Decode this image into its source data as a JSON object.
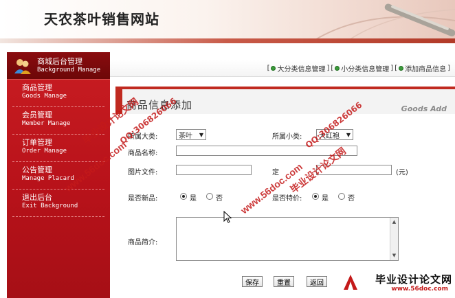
{
  "site": {
    "title": "天农茶叶销售网站"
  },
  "sidebar": {
    "header": {
      "cn": "商城后台管理",
      "en": "Background Manage"
    },
    "items": [
      {
        "cn": "商品管理",
        "en": "Goods Manage"
      },
      {
        "cn": "会员管理",
        "en": "Member Manage"
      },
      {
        "cn": "订单管理",
        "en": "Order Manage"
      },
      {
        "cn": "公告管理",
        "en": "Manage Placard"
      },
      {
        "cn": "退出后台",
        "en": "Exit Background"
      }
    ]
  },
  "topnav": {
    "links": [
      "大分类信息管理",
      "小分类信息管理",
      "添加商品信息"
    ],
    "bracket_open": "[",
    "bracket_close": "]"
  },
  "panel": {
    "title": "商品信息添加",
    "title_en": "Goods Add"
  },
  "form": {
    "category_label": "所属大类:",
    "category_value": "茶叶",
    "subcategory_label": "所属小类:",
    "subcategory_value": "大红袍",
    "name_label": "商品名称:",
    "name_value": "",
    "image_label": "图片文件:",
    "image_value": "",
    "price_label": "定",
    "price_value": "",
    "price_unit": "(元)",
    "new_label": "是否新品:",
    "special_label": "是否特价:",
    "yes": "是",
    "no": "否",
    "new_selected": "是",
    "special_selected": "是",
    "intro_label": "商品简介:",
    "intro_value": "",
    "save_label": "保存",
    "reset_label": "重置",
    "back_label": "返回"
  },
  "watermarks": {
    "brand": "毕业设计论文网",
    "url": "www.56doc.com",
    "qq": "QQ:306826066"
  },
  "footer_logo": {
    "cn": "毕业设计论文网",
    "url": "www.56doc.com"
  },
  "colors": {
    "sidebar_red": "#b8121a",
    "accent_red": "#c02a20",
    "nav_dot": "#3c9a3c"
  }
}
